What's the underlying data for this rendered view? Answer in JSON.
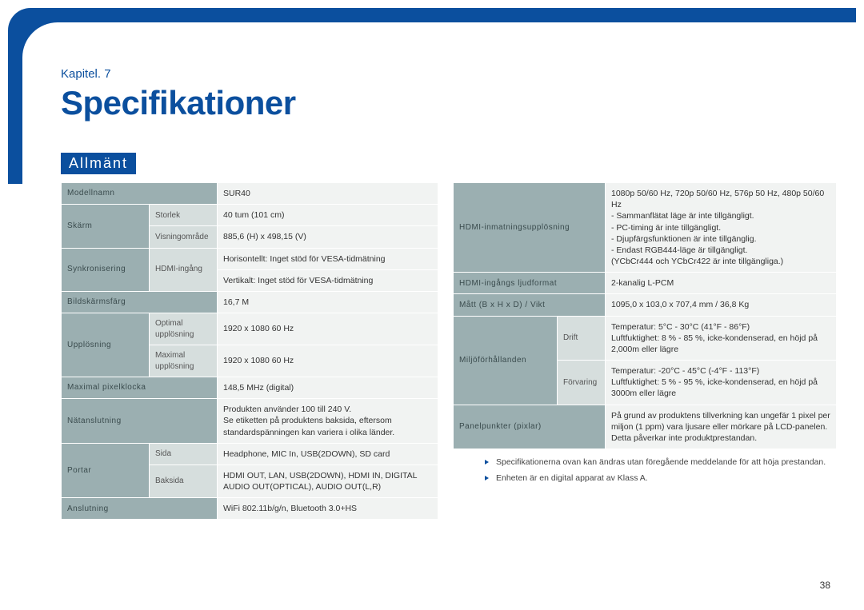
{
  "page_number": "38",
  "header": {
    "chapter": "Kapitel. 7",
    "title": "Specifikationer",
    "section": "Allmänt"
  },
  "left_table": {
    "model_name_label": "Modellnamn",
    "model_name": "SUR40",
    "screen_label": "Skärm",
    "size_label": "Storlek",
    "size_value": "40 tum (101 cm)",
    "viewarea_label": "Visningområde",
    "viewarea_value": "885,6 (H) x 498,15 (V)",
    "sync_label": "Synkronisering",
    "hdmi_in_label": "HDMI-ingång",
    "sync_horiz": "Horisontellt: Inget stöd för VESA-tidmätning",
    "sync_vert": "Vertikalt: Inget stöd för VESA-tidmätning",
    "color_label": "Bildskärmsfärg",
    "color_value": "16,7 M",
    "resolution_label": "Upplösning",
    "optres_label": "Optimal upplösning",
    "optres_value": "1920 x 1080 60 Hz",
    "maxres_label": "Maximal upplösning",
    "maxres_value": "1920 x 1080 60 Hz",
    "pixelclock_label": "Maximal pixelklocka",
    "pixelclock_value": "148,5 MHz (digital)",
    "power_label": "Nätanslutning",
    "power_value": "Produkten använder 100 till 240 V.\nSe etiketten på produktens baksida, eftersom standardspänningen kan variera i olika länder.",
    "ports_label": "Portar",
    "side_label": "Sida",
    "side_value": "Headphone, MIC In, USB(2DOWN), SD card",
    "rear_label": "Baksida",
    "rear_value": "HDMI OUT, LAN, USB(2DOWN), HDMI IN, DIGITAL AUDIO OUT(OPTICAL), AUDIO OUT(L,R)",
    "connection_label": "Anslutning",
    "connection_value": "WiFi 802.11b/g/n, Bluetooth 3.0+HS"
  },
  "right_table": {
    "hdmi_res_label": "HDMI-inmatningsupplösning",
    "hdmi_res_value": "1080p 50/60 Hz, 720p 50/60 Hz, 576p 50 Hz, 480p 50/60 Hz\n- Sammanflätat läge är inte tillgängligt.\n- PC-timing är inte tillgängligt.\n- Djupfärgsfunktionen är inte tillgänglig.\n- Endast RGB444-läge är tillgängligt.\n  (YCbCr444 och YCbCr422 är inte tillgängliga.)",
    "hdmi_audio_label": "HDMI-ingångs ljudformat",
    "hdmi_audio_value": "2-kanalig L-PCM",
    "dims_label": "Mått (B x H x D) / Vikt",
    "dims_value": "1095,0 x 103,0 x 707,4 mm / 36,8 Kg",
    "env_label": "Miljöförhållanden",
    "op_label": "Drift",
    "op_value": "Temperatur: 5°C - 30°C (41°F - 86°F)\nLuftfuktighet: 8 % - 85 %, icke-kondenserad, en höjd på 2,000m eller lägre",
    "storage_label": "Förvaring",
    "storage_value": "Temperatur:  -20°C - 45°C (-4°F - 113°F)\nLuftfuktighet: 5 % - 95 %, icke-kondenserad, en höjd på 3000m eller lägre",
    "pixels_label": "Panelpunkter (pixlar)",
    "pixels_value": "På grund av produktens tillverkning kan ungefär 1 pixel per miljon (1 ppm) vara ljusare eller mörkare på LCD-panelen. Detta påverkar inte produktprestandan."
  },
  "notes": {
    "n1": "Specifikationerna ovan kan ändras utan föregående meddelande för att höja prestandan.",
    "n2": "Enheten är en digital apparat av Klass A."
  }
}
